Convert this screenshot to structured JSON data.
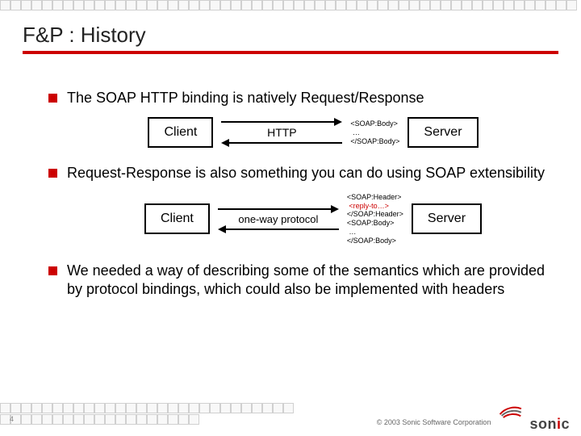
{
  "title": "F&P : History",
  "bullets": [
    "The SOAP HTTP binding is natively Request/Response",
    "Request-Response is also something you can do using SOAP extensibility",
    "We needed a way of describing some of the semantics which are provided by protocol bindings, which could also be implemented with headers"
  ],
  "diagram1": {
    "left": "Client",
    "mid": "HTTP",
    "right": "Server",
    "code": "<SOAP:Body>\n …\n</SOAP:Body>"
  },
  "diagram2": {
    "left": "Client",
    "mid": "one-way protocol",
    "right": "Server",
    "code_pre": "<SOAP:Header>\n ",
    "code_red": "<reply-to…>",
    "code_post": "\n</SOAP:Header>\n<SOAP:Body>\n …\n</SOAP:Body>"
  },
  "footer": {
    "copyright": "© 2003 Sonic Software Corporation",
    "logo": "sonic",
    "page": "4"
  }
}
